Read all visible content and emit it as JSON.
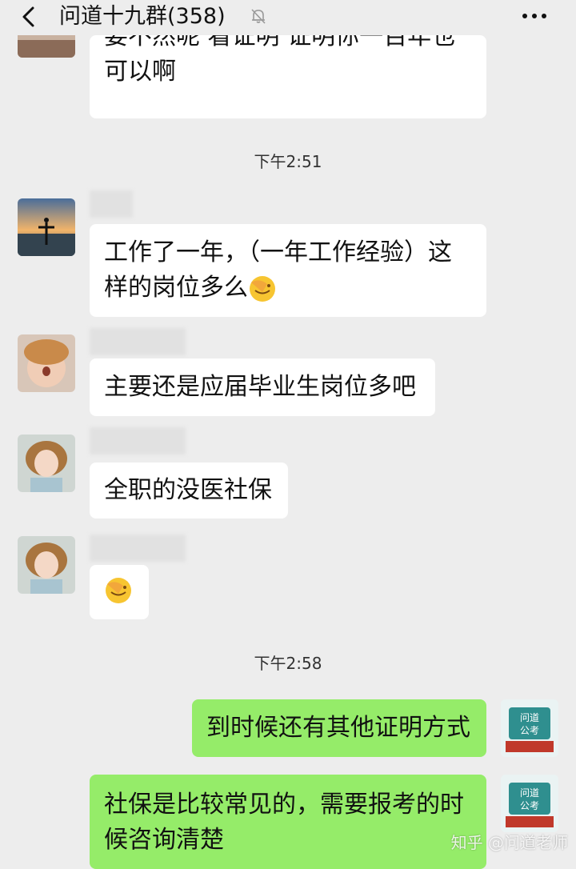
{
  "header": {
    "title": "问道十九群(358)",
    "back_icon": "chevron-left-icon",
    "mute_icon": "bell-muted-icon",
    "more_icon": "more-dots-icon"
  },
  "messages": {
    "m0_line1": "要不然呢 看证明 证明你一百年也",
    "m0_line2": "可以啊",
    "time1": "下午2:51",
    "m1_line1": "工作了一年，（一年工作经验）这",
    "m1_line2": "样的岗位多么",
    "m2": "主要还是应届毕业生岗位多吧",
    "m3": "全职的没医社保",
    "time2": "下午2:58",
    "m5": "到时候还有其他证明方式",
    "m6_line1": "社保是比较常见的，需要报考的时",
    "m6_line2": "候咨询清楚",
    "avatar_badge": "问道\n公考",
    "avatar_badge_line1": "问道",
    "avatar_badge_line2": "公考"
  },
  "watermark": "知乎 @问道老师",
  "colors": {
    "background": "#ededed",
    "incoming_bubble": "#ffffff",
    "outgoing_bubble": "#95ec69"
  }
}
